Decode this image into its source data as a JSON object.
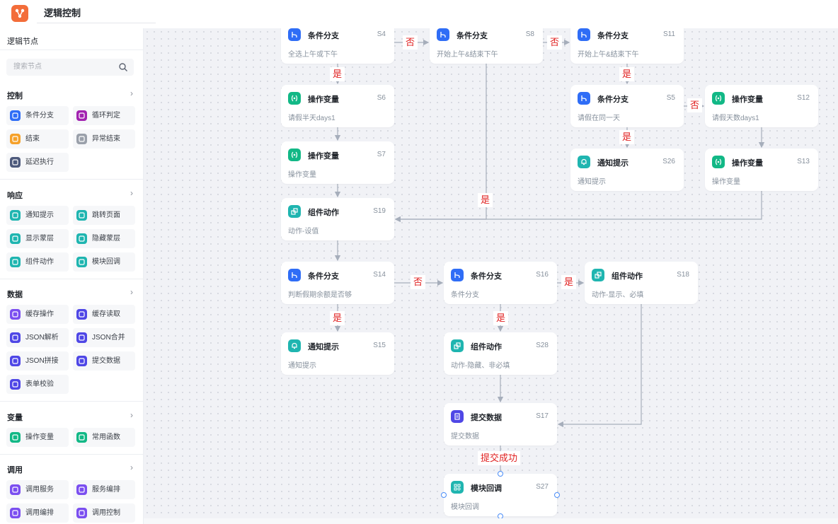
{
  "header": {
    "title": "逻辑控制"
  },
  "sidebar": {
    "title": "逻辑节点",
    "search_placeholder": "搜索节点",
    "sections": [
      {
        "name": "控制",
        "items": [
          {
            "label": "条件分支",
            "color": "#2f6df6"
          },
          {
            "label": "循环判定",
            "color": "#a223b0"
          },
          {
            "label": "结束",
            "color": "#f5a12a"
          },
          {
            "label": "异常结束",
            "color": "#9aa0aa"
          },
          {
            "label": "延迟执行",
            "color": "#4d5a7c"
          }
        ]
      },
      {
        "name": "响应",
        "items": [
          {
            "label": "通知提示",
            "color": "#1fb5b0"
          },
          {
            "label": "跳转页面",
            "color": "#1fb5b0"
          },
          {
            "label": "显示蒙层",
            "color": "#1fb5b0"
          },
          {
            "label": "隐藏蒙层",
            "color": "#1fb5b0"
          },
          {
            "label": "组件动作",
            "color": "#1fb5b0"
          },
          {
            "label": "模块回调",
            "color": "#1fb5b0"
          }
        ]
      },
      {
        "name": "数据",
        "items": [
          {
            "label": "缓存操作",
            "color": "#7b4ff0"
          },
          {
            "label": "缓存读取",
            "color": "#4f47e6"
          },
          {
            "label": "JSON解析",
            "color": "#4f47e6"
          },
          {
            "label": "JSON合并",
            "color": "#4f47e6"
          },
          {
            "label": "JSON拼接",
            "color": "#4f47e6"
          },
          {
            "label": "提交数据",
            "color": "#4f47e6"
          },
          {
            "label": "表单校验",
            "color": "#4f47e6"
          }
        ]
      },
      {
        "name": "变量",
        "items": [
          {
            "label": "操作变量",
            "color": "#12b886"
          },
          {
            "label": "常用函数",
            "color": "#12b886"
          }
        ]
      },
      {
        "name": "调用",
        "items": [
          {
            "label": "调用服务",
            "color": "#7b4ff0"
          },
          {
            "label": "服务编排",
            "color": "#7b4ff0"
          },
          {
            "label": "调用编排",
            "color": "#7b4ff0"
          },
          {
            "label": "调用控制",
            "color": "#7b4ff0"
          }
        ]
      }
    ]
  },
  "flow": {
    "nodes": [
      {
        "id": "S4",
        "title": "条件分支",
        "subtitle": "全选上午或下午",
        "type": "branch"
      },
      {
        "id": "S8",
        "title": "条件分支",
        "subtitle": "开始上午&结束下午",
        "type": "branch"
      },
      {
        "id": "S11",
        "title": "条件分支",
        "subtitle": "开始上午&结束下午",
        "type": "branch"
      },
      {
        "id": "S6",
        "title": "操作变量",
        "subtitle": "请假半天days1",
        "type": "variable"
      },
      {
        "id": "S5",
        "title": "条件分支",
        "subtitle": "请假在同一天",
        "type": "branch"
      },
      {
        "id": "S12",
        "title": "操作变量",
        "subtitle": "请假天数days1",
        "type": "variable"
      },
      {
        "id": "S7",
        "title": "操作变量",
        "subtitle": "操作变量",
        "type": "variable"
      },
      {
        "id": "S26",
        "title": "通知提示",
        "subtitle": "通知提示",
        "type": "notify"
      },
      {
        "id": "S13",
        "title": "操作变量",
        "subtitle": "操作变量",
        "type": "variable"
      },
      {
        "id": "S19",
        "title": "组件动作",
        "subtitle": "动作-设值",
        "type": "action"
      },
      {
        "id": "S14",
        "title": "条件分支",
        "subtitle": "判断假期余额是否够",
        "type": "branch"
      },
      {
        "id": "S16",
        "title": "条件分支",
        "subtitle": "条件分支",
        "type": "branch"
      },
      {
        "id": "S18",
        "title": "组件动作",
        "subtitle": "动作-显示、必填",
        "type": "action"
      },
      {
        "id": "S15",
        "title": "通知提示",
        "subtitle": "通知提示",
        "type": "notify"
      },
      {
        "id": "S28",
        "title": "组件动作",
        "subtitle": "动作-隐藏、非必填",
        "type": "action"
      },
      {
        "id": "S17",
        "title": "提交数据",
        "subtitle": "提交数据",
        "type": "submit"
      },
      {
        "id": "S27",
        "title": "模块回调",
        "subtitle": "模块回调",
        "type": "callback"
      }
    ],
    "edge_labels": {
      "yes": "是",
      "no": "否",
      "submit_success": "提交成功"
    },
    "type_colors": {
      "branch": "#2f6df6",
      "variable": "#12b886",
      "notify": "#1fb5b0",
      "action": "#1fb5b0",
      "submit": "#4f47e6",
      "callback": "#1fb5b0"
    }
  }
}
